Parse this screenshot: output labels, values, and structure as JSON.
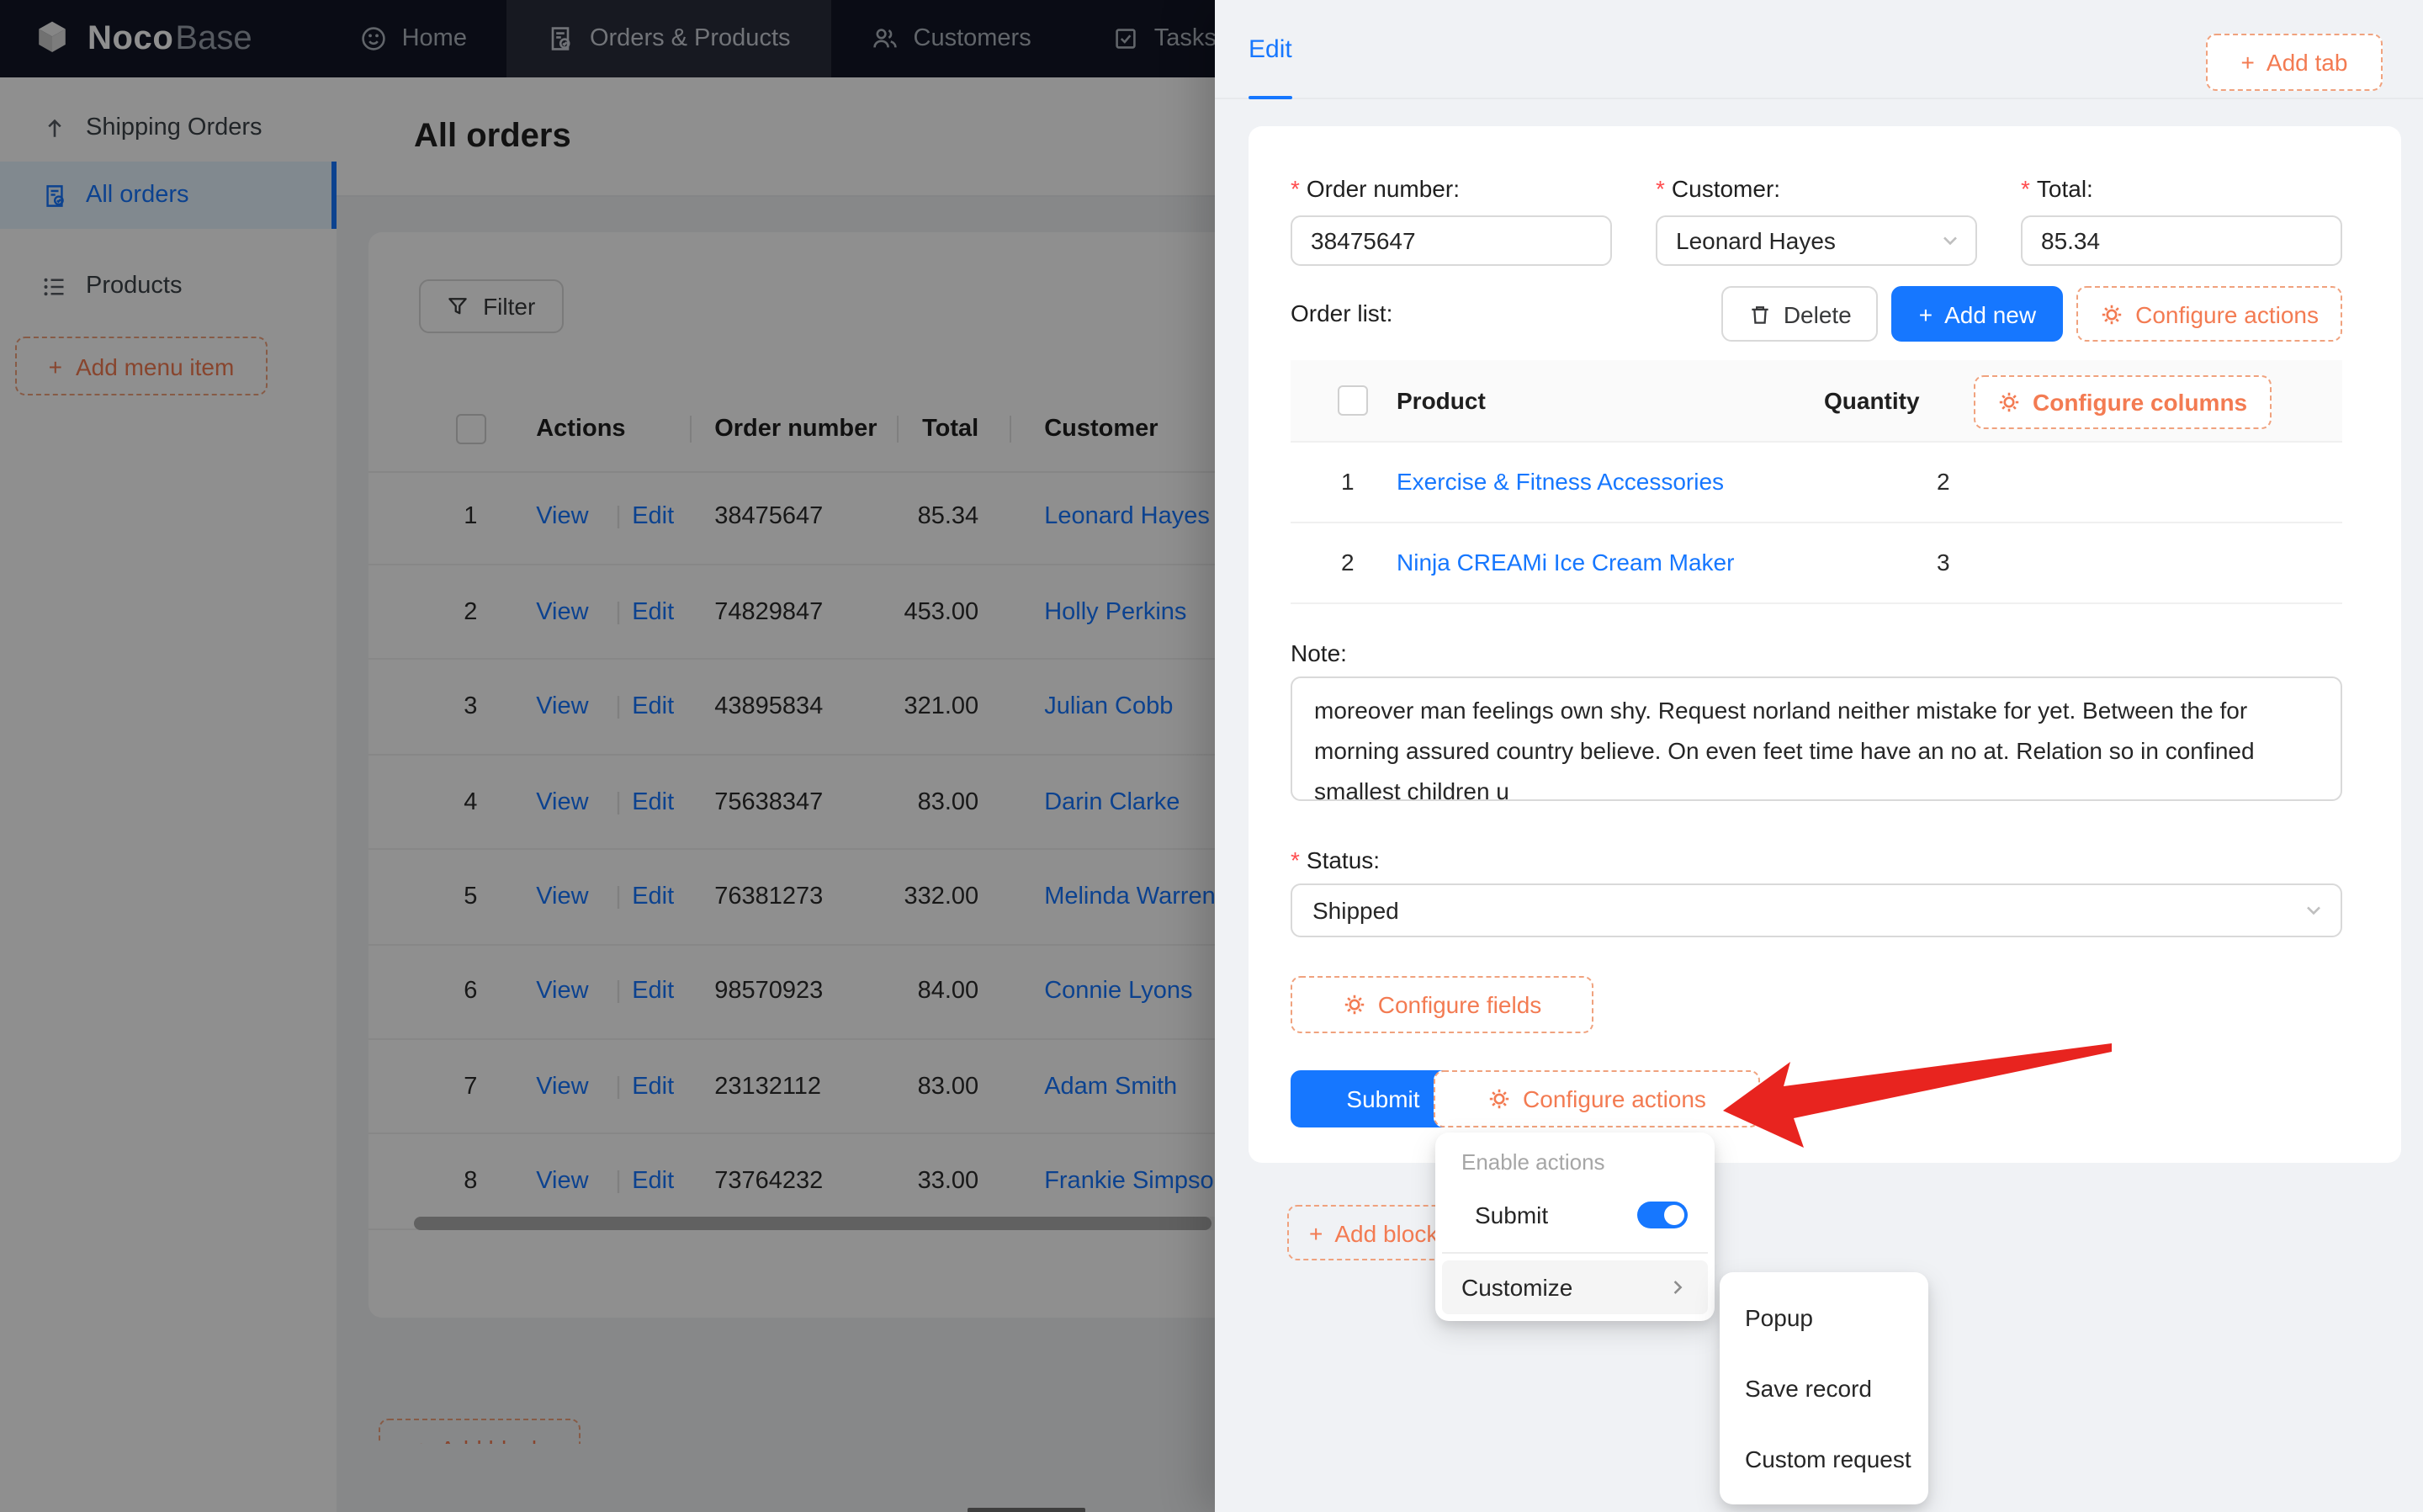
{
  "navbar": {
    "logo": {
      "noco": "Noco",
      "base": "Base"
    },
    "items": [
      {
        "label": "Home",
        "icon": "smiley-icon",
        "active": false
      },
      {
        "label": "Orders & Products",
        "icon": "order-doc-icon",
        "active": true
      },
      {
        "label": "Customers",
        "icon": "people-icon",
        "active": false
      },
      {
        "label": "Tasks",
        "icon": "check-square-icon",
        "active": false
      }
    ]
  },
  "sidebar": {
    "items": [
      {
        "label": "Shipping Orders",
        "icon": "arrow-up-icon",
        "active": false
      },
      {
        "label": "All orders",
        "icon": "order-doc-icon",
        "active": true
      },
      {
        "label": "Products",
        "icon": "list-icon",
        "active": false
      }
    ],
    "add_menu_item_label": "Add menu item"
  },
  "page": {
    "title": "All orders",
    "filter_label": "Filter",
    "add_block_label": "Add block"
  },
  "orders_table": {
    "columns": {
      "actions": "Actions",
      "order_number": "Order number",
      "total": "Total",
      "customer": "Customer"
    },
    "action_labels": {
      "view": "View",
      "edit": "Edit",
      "separator": "|"
    },
    "rows": [
      {
        "index": "1",
        "order_number": "38475647",
        "total": "85.34",
        "customer": "Leonard Hayes"
      },
      {
        "index": "2",
        "order_number": "74829847",
        "total": "453.00",
        "customer": "Holly Perkins"
      },
      {
        "index": "3",
        "order_number": "43895834",
        "total": "321.00",
        "customer": "Julian Cobb"
      },
      {
        "index": "4",
        "order_number": "75638347",
        "total": "83.00",
        "customer": "Darin Clarke"
      },
      {
        "index": "5",
        "order_number": "76381273",
        "total": "332.00",
        "customer": "Melinda Warren"
      },
      {
        "index": "6",
        "order_number": "98570923",
        "total": "84.00",
        "customer": "Connie Lyons"
      },
      {
        "index": "7",
        "order_number": "23132112",
        "total": "83.00",
        "customer": "Adam Smith"
      },
      {
        "index": "8",
        "order_number": "73764232",
        "total": "33.00",
        "customer": "Frankie Simpson"
      }
    ]
  },
  "drawer": {
    "tab_label": "Edit",
    "add_tab_label": "Add tab",
    "form": {
      "order_number": {
        "label": "Order number:",
        "value": "38475647"
      },
      "customer": {
        "label": "Customer:",
        "value": "Leonard Hayes"
      },
      "total": {
        "label": "Total:",
        "value": "85.34"
      },
      "order_list_label": "Order list:",
      "note_label": "Note:",
      "note_value": "moreover man feelings own shy. Request norland neither mistake for yet. Between the for morning assured country believe. On even feet time have an no at. Relation so in confined smallest children u",
      "status_label": "Status:",
      "status_value": "Shipped"
    },
    "buttons": {
      "delete": "Delete",
      "add_new": "Add new",
      "configure_actions": "Configure actions",
      "configure_columns": "Configure columns",
      "configure_fields": "Configure fields",
      "submit": "Submit",
      "add_block": "Add block"
    },
    "products_table": {
      "columns": {
        "product": "Product",
        "quantity": "Quantity"
      },
      "rows": [
        {
          "index": "1",
          "product": "Exercise & Fitness Accessories",
          "quantity": "2"
        },
        {
          "index": "2",
          "product": "Ninja CREAMi Ice Cream Maker",
          "quantity": "3"
        }
      ]
    }
  },
  "actions_menu": {
    "group_label": "Enable actions",
    "submit_item": {
      "label": "Submit",
      "enabled": true
    },
    "customize_label": "Customize"
  },
  "customize_submenu": {
    "items": [
      "Popup",
      "Save record",
      "Custom request"
    ]
  },
  "colors": {
    "accent_blue": "#1677ff",
    "designer_orange": "#f37b52",
    "arrow_red": "#e8241f",
    "navbar_bg": "#121726",
    "drawer_bg": "#f0f2f5"
  }
}
